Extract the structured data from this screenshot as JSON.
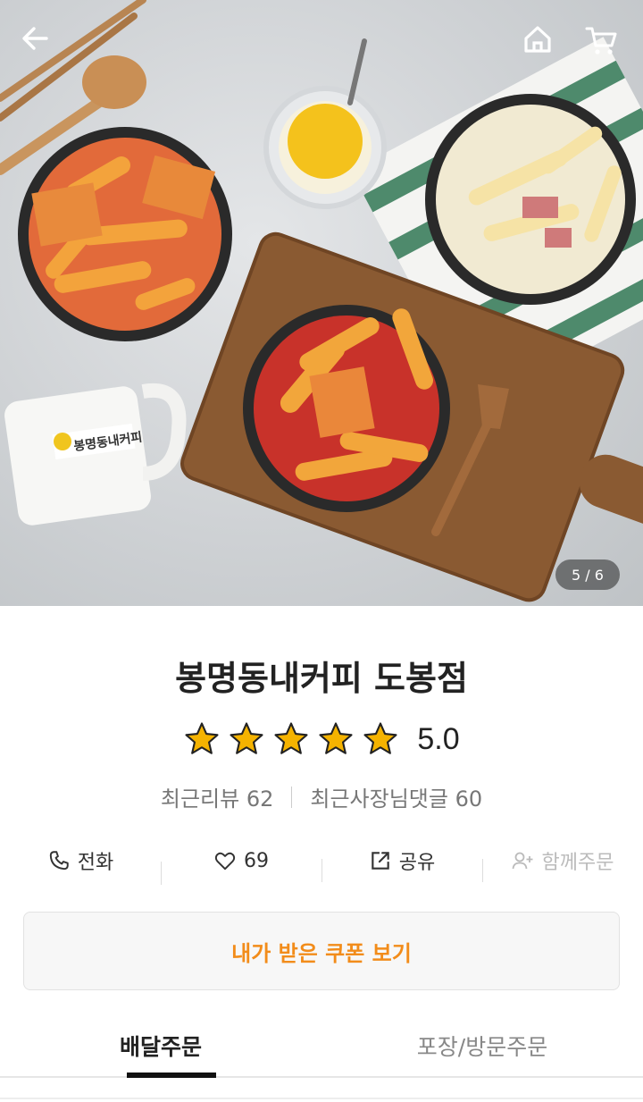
{
  "hero": {
    "page_indicator": "5 / 6",
    "mug_brand": "봉명동내커피"
  },
  "top_bar": {
    "back_icon": "arrow-left-icon",
    "home_icon": "home-icon",
    "cart_icon": "cart-icon"
  },
  "store": {
    "name": "봉명동내커피 도봉점",
    "rating": "5.0",
    "rating_stars": 5,
    "reviews": "최근리뷰 62",
    "owner_replies": "최근사장님댓글 60"
  },
  "actions": {
    "call": "전화",
    "likes": "69",
    "share": "공유",
    "group_order": "함께주문"
  },
  "coupon": {
    "label": "내가 받은 쿠폰 보기"
  },
  "tabs": [
    {
      "label": "배달주문",
      "active": true
    },
    {
      "label": "포장/방문주문",
      "active": false
    }
  ],
  "colors": {
    "accent": "#f28c1a",
    "star": "#f5b300"
  }
}
